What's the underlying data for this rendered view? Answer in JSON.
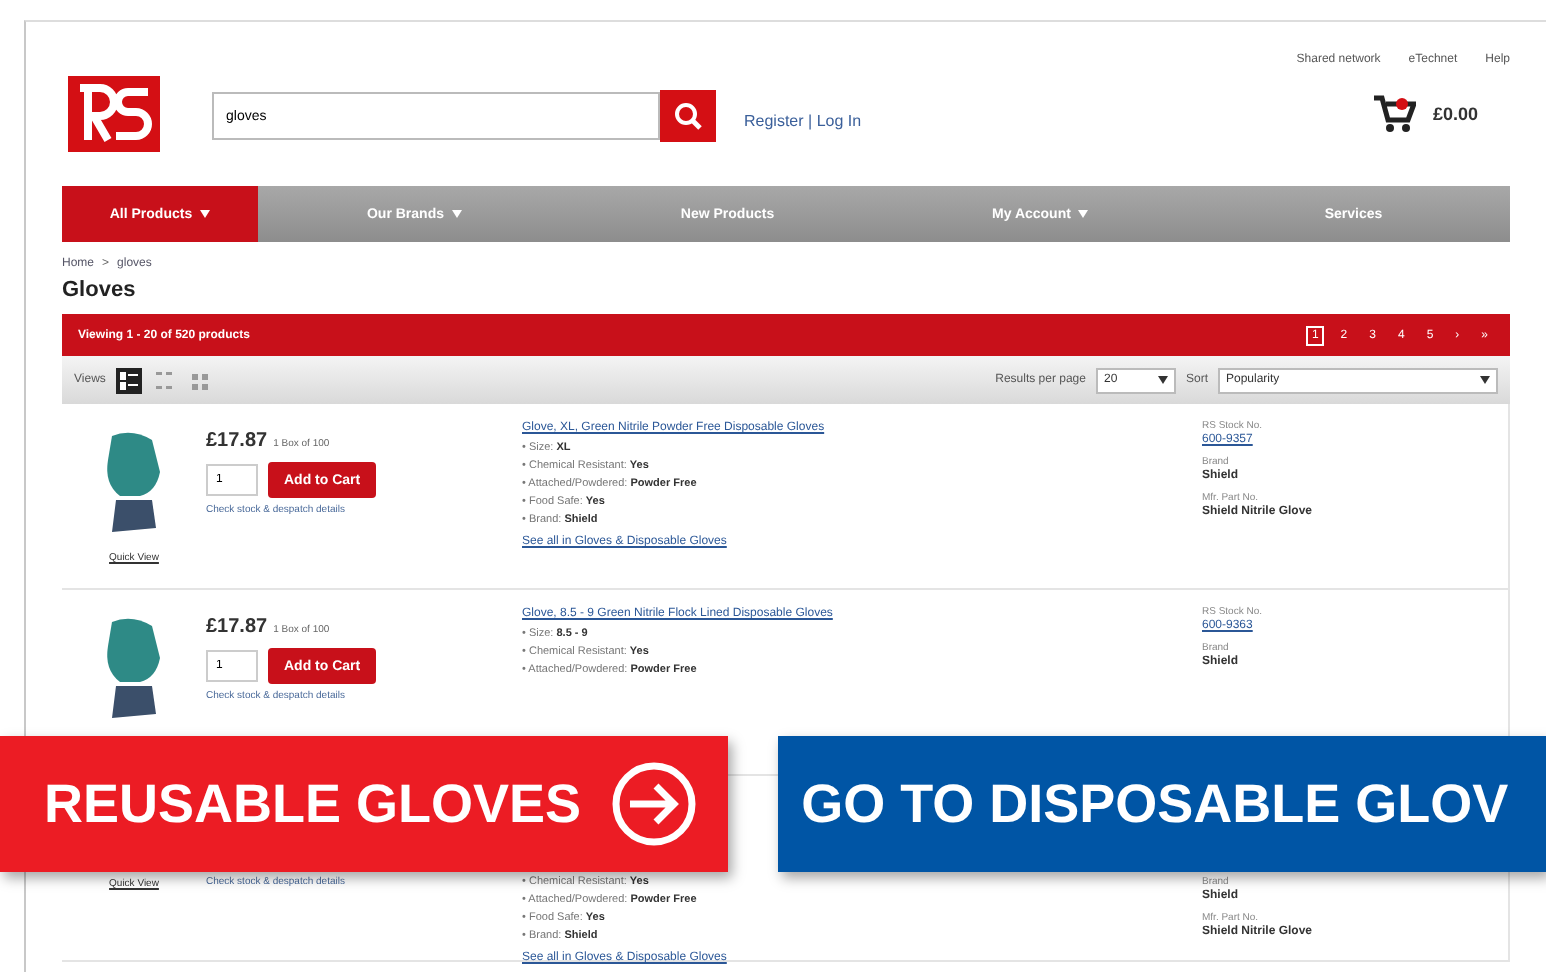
{
  "top_links": [
    "Shared network",
    "eTechnet",
    "Help"
  ],
  "search": {
    "value": "gloves"
  },
  "account_link": "Register | Log In",
  "cart_total": "£0.00",
  "nav": [
    {
      "label": "All Products",
      "selected": true,
      "dropdown": true
    },
    {
      "label": "Our Brands",
      "selected": false,
      "dropdown": true
    },
    {
      "label": "New Products",
      "selected": false,
      "dropdown": false
    },
    {
      "label": "My Account",
      "selected": false,
      "dropdown": true
    },
    {
      "label": "Services",
      "selected": false,
      "dropdown": false
    }
  ],
  "breadcrumb": {
    "items": [
      "Home",
      "gloves"
    ],
    "separator": ">"
  },
  "heading": "Gloves",
  "results_bar": {
    "summary": "Viewing 1 - 20 of 520 products",
    "pages": [
      {
        "label": "1",
        "selected": true
      },
      {
        "label": "2",
        "selected": false
      },
      {
        "label": "3",
        "selected": false
      },
      {
        "label": "4",
        "selected": false
      },
      {
        "label": "5",
        "selected": false
      }
    ],
    "arrows": [
      "›",
      "»"
    ]
  },
  "bullet": "•",
  "toolbar": {
    "views_label": "Views",
    "views": [
      {
        "kind": "list",
        "selected": true
      },
      {
        "kind": "grid",
        "selected": false
      },
      {
        "kind": "tiles",
        "selected": false
      }
    ],
    "per_page_label": "Results per page",
    "per_page": "20",
    "sort_label": "Sort",
    "sort": "Popularity"
  },
  "rows": [
    {
      "price": "£17.87",
      "unit": "1 Box of 100",
      "qty": "1",
      "button": "Add to Cart",
      "note": "Check stock & despatch details",
      "quick_view": "Quick View",
      "title": "Glove, XL, Green Nitrile Powder Free Disposable Gloves",
      "specs": [
        {
          "label": "Size:",
          "value": "XL"
        },
        {
          "label": "Chemical Resistant:",
          "value": "Yes"
        },
        {
          "label": "Attached/Powdered:",
          "value": "Powder Free"
        },
        {
          "label": "Food Safe:",
          "value": "Yes"
        },
        {
          "label": "Brand:",
          "value": "Shield"
        }
      ],
      "see_all": "See all in Gloves & Disposable Gloves",
      "side": [
        {
          "kind": "label",
          "text": "RS Stock No."
        },
        {
          "kind": "link",
          "text": "600-9357"
        },
        {
          "kind": "label",
          "text": "Brand"
        },
        {
          "kind": "value",
          "text": "Shield"
        },
        {
          "kind": "label",
          "text": "Mfr. Part No."
        },
        {
          "kind": "value",
          "text": "Shield Nitrile Glove"
        }
      ]
    },
    {
      "price": "£17.87",
      "unit": "1 Box of 100",
      "qty": "1",
      "button": "Add to Cart",
      "note": "Check stock & despatch details",
      "title": "Glove, 8.5 - 9 Green Nitrile Flock Lined Disposable Gloves",
      "specs": [
        {
          "label": "Size:",
          "value": "8.5 - 9"
        },
        {
          "label": "Chemical Resistant:",
          "value": "Yes"
        },
        {
          "label": "Attached/Powdered:",
          "value": "Powder Free"
        }
      ],
      "side": [
        {
          "kind": "label",
          "text": "RS Stock No."
        },
        {
          "kind": "link",
          "text": "600-9363"
        },
        {
          "kind": "label",
          "text": "Brand"
        },
        {
          "kind": "value",
          "text": "Shield"
        }
      ]
    },
    {
      "note": "Check stock & despatch details",
      "quick_view": "Quick View",
      "specs": [
        {
          "label": "Chemical Resistant:",
          "value": "Yes"
        },
        {
          "label": "Attached/Powdered:",
          "value": "Powder Free"
        },
        {
          "label": "Food Safe:",
          "value": "Yes"
        },
        {
          "label": "Brand:",
          "value": "Shield"
        }
      ],
      "see_all": "See all in Gloves & Disposable Gloves",
      "side": [
        {
          "kind": "label",
          "text": "Brand"
        },
        {
          "kind": "value",
          "text": "Shield"
        },
        {
          "kind": "label",
          "text": "Mfr. Part No."
        },
        {
          "kind": "value",
          "text": "Shield Nitrile Glove"
        }
      ]
    }
  ],
  "banners": [
    {
      "kind": "reusable",
      "text": "REUSABLE GLOVES",
      "arrow": true
    },
    {
      "kind": "disposable",
      "text": "GO TO DISPOSABLE GLOV",
      "arrow": false
    }
  ]
}
